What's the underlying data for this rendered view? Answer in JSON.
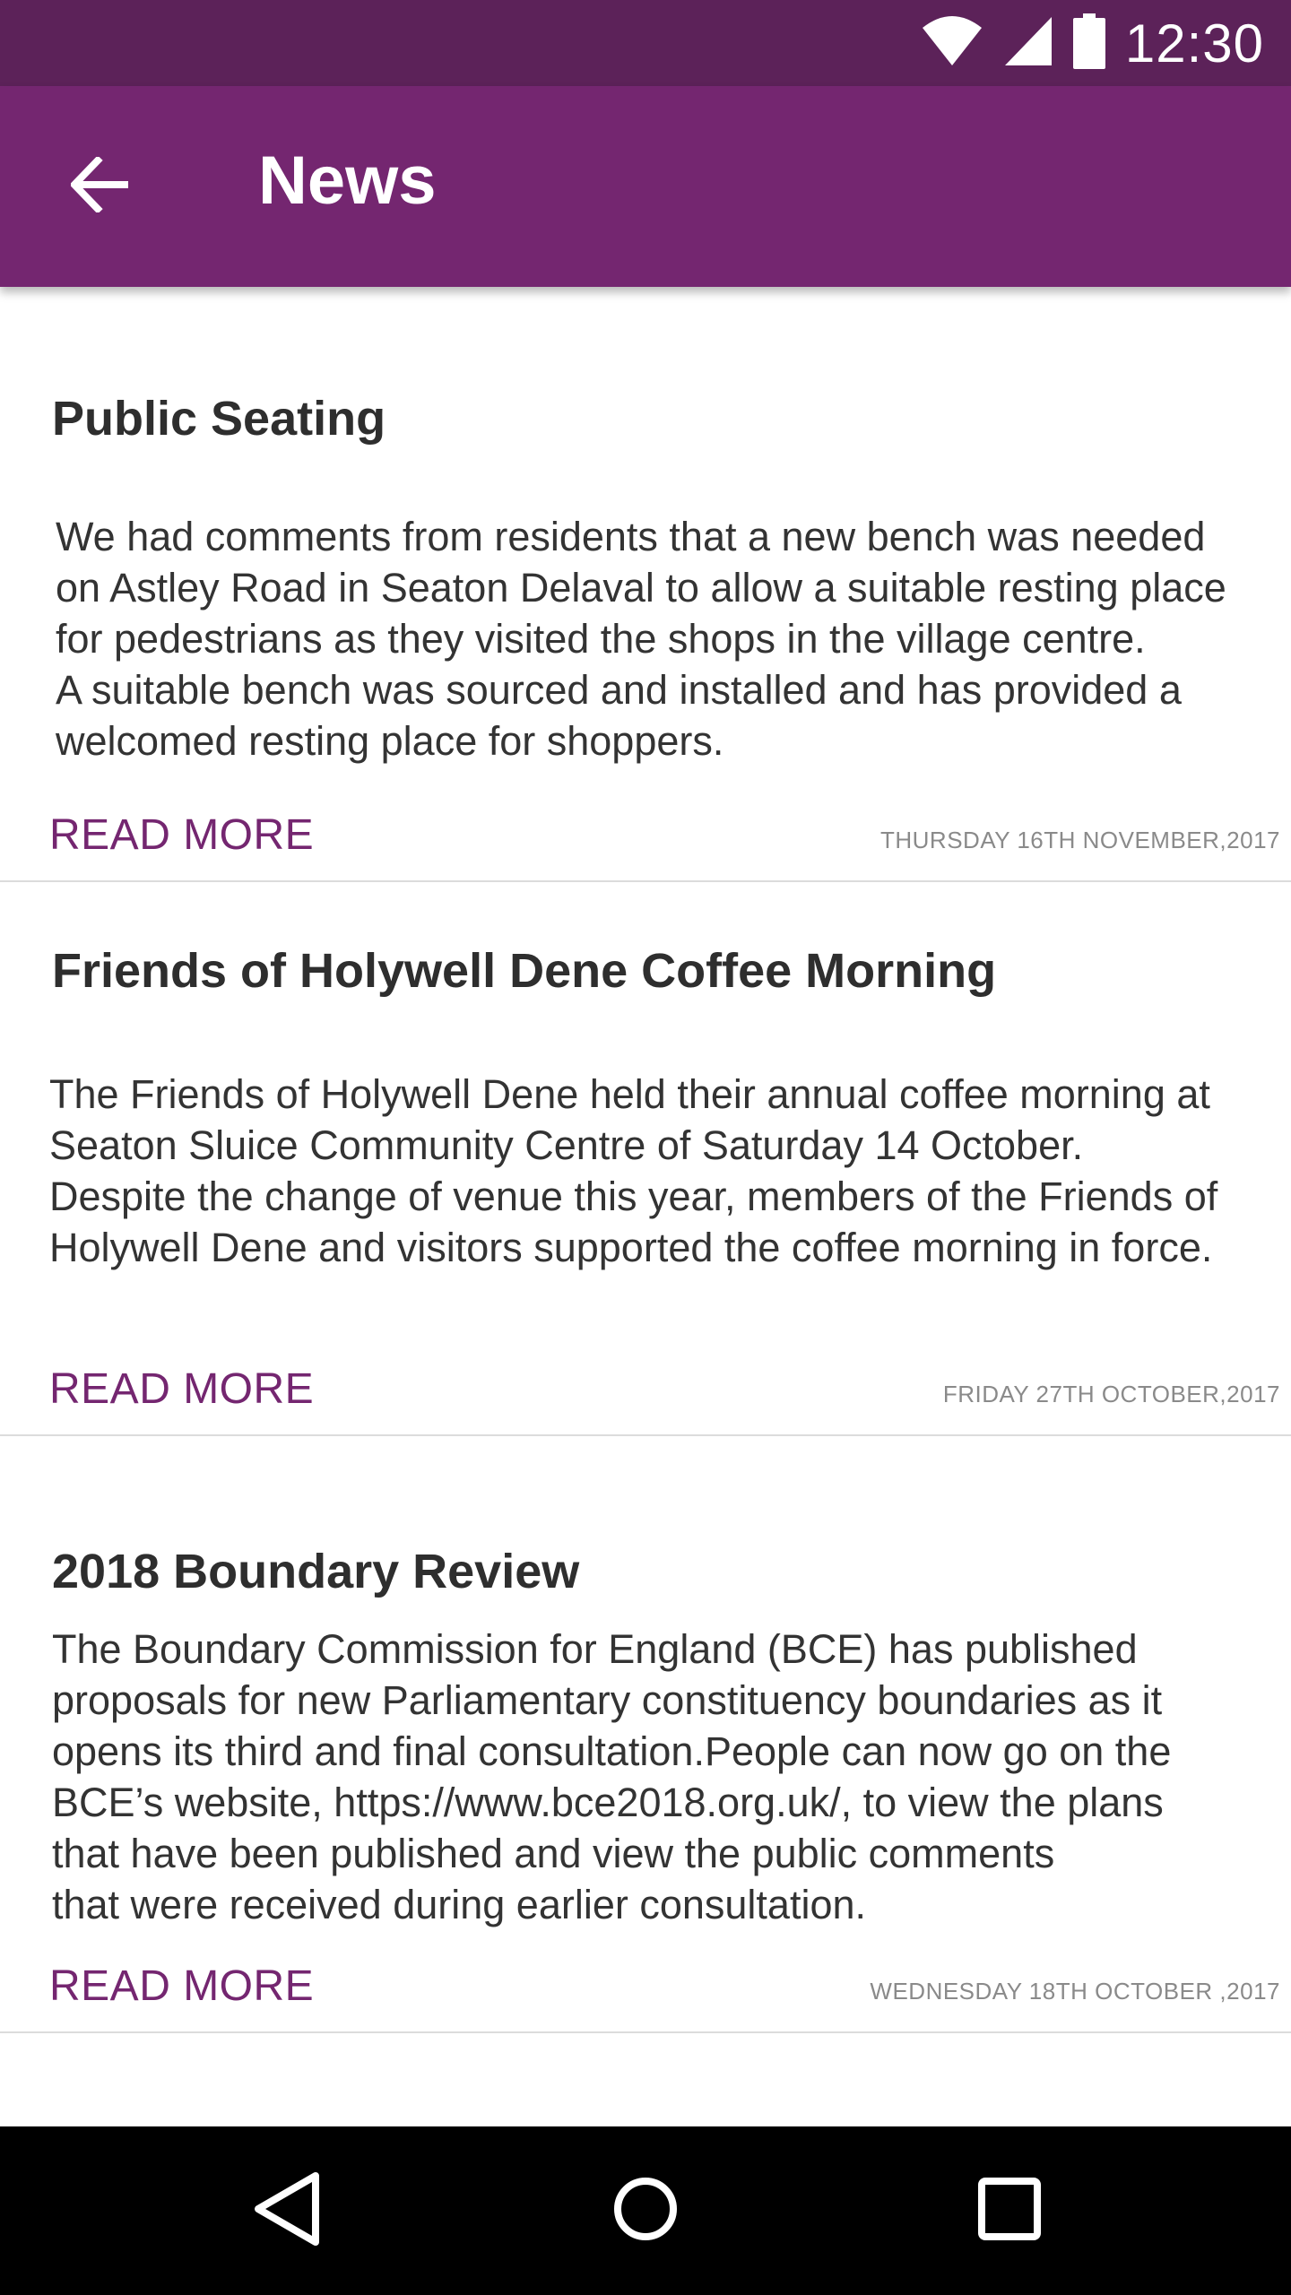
{
  "status_bar": {
    "time": "12:30",
    "icons": [
      "wifi-icon",
      "cellular-signal-icon",
      "battery-icon"
    ],
    "background": "#5c2259"
  },
  "app_bar": {
    "title": "News",
    "back_icon": "arrow-back-icon",
    "background": "#742670"
  },
  "news": [
    {
      "title": "Public Seating",
      "body_lines": [
        "We had comments from residents that a new bench was needed",
        "on Astley Road in Seaton Delaval to allow a suitable resting place",
        "for pedestrians as they visited the shops in the village centre.",
        "A suitable bench was sourced and installed and has provided a",
        "welcomed resting place for shoppers."
      ],
      "read_more": "READ MORE",
      "date": "THURSDAY 16TH NOVEMBER,2017"
    },
    {
      "title": "Friends of Holywell Dene Coffee Morning",
      "body_lines": [
        "The Friends of Holywell Dene held their annual coffee morning at",
        "Seaton Sluice Community Centre of Saturday 14 October.",
        "Despite the change of venue this year, members of the Friends of",
        "Holywell Dene and visitors supported the coffee morning in force."
      ],
      "read_more": "READ MORE",
      "date": "FRIDAY 27TH OCTOBER,2017"
    },
    {
      "title": "2018 Boundary Review",
      "body_lines": [
        "The Boundary Commission for England (BCE) has published",
        "proposals for new Parliamentary constituency boundaries as it",
        "opens its third and final consultation.People can now go on the",
        "BCE’s website, https://www.bce2018.org.uk/, to view the plans",
        "that have been published and view the public comments",
        "that were received during earlier consultation."
      ],
      "read_more": "READ MORE",
      "date": "WEDNESDAY 18TH OCTOBER ,2017"
    }
  ],
  "nav_bar": {
    "buttons": [
      "back-triangle-icon",
      "home-circle-icon",
      "recents-square-icon"
    ]
  },
  "colors": {
    "accent": "#742670",
    "status_bar": "#5c2259",
    "title_text": "#2e2e2e",
    "date_text": "#8a8a8a",
    "divider": "#dcdcdc"
  }
}
